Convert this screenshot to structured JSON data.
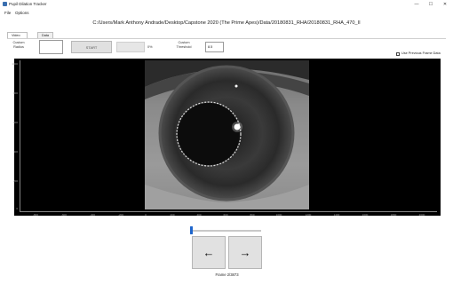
{
  "window": {
    "title": "Pupil Dilation Tracker",
    "minimize": "—",
    "maximize": "☐",
    "close": "✕"
  },
  "menu": {
    "items": [
      "File",
      "Options"
    ]
  },
  "path": "C:/Users/Mark Anthony Andrade/Desktop/Capstone 2020 (The Prime Apes)/Data/20180831_RHA/20180831_RHA_470_II",
  "tabs": [
    {
      "label": "Video Frames",
      "active": true
    },
    {
      "label": "Data",
      "active": false
    }
  ],
  "controls": {
    "custom_radius_label": "Custom Radius",
    "custom_radius_value": "",
    "start_label": "START",
    "progress_percent_label": "0%",
    "progress": 0,
    "custom_threshold_label": "Custom Threshold",
    "threshold_value": "8.5",
    "use_previous_label": "Use Previous Frame Data",
    "use_previous_checked": false
  },
  "plot": {
    "y_ticks": [
      "1000",
      "800",
      "600",
      "400",
      "200",
      "0"
    ],
    "x_ticks": [
      "-800",
      "-600",
      "-400",
      "-200",
      "0",
      "200",
      "400",
      "600",
      "800",
      "1000",
      "1200",
      "1400",
      "1600",
      "1800",
      "2000"
    ]
  },
  "navigation": {
    "prev_icon": "left-arrow-icon",
    "next_icon": "right-arrow-icon",
    "prev_glyph": "←",
    "next_glyph": "→",
    "frame_label": "Frame 2/3873",
    "current_frame": 2,
    "total_frames": 3873
  },
  "colors": {
    "accent": "#1f66cc",
    "progress": "#06b025",
    "plot_bg": "#000000"
  }
}
